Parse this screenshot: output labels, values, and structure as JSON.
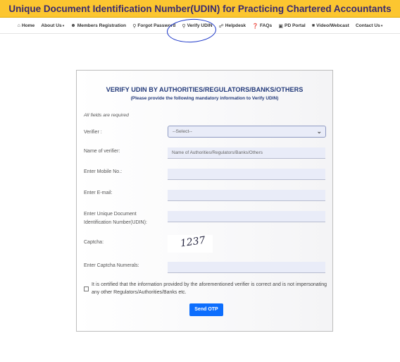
{
  "banner": {
    "title": "Unique Document Identification Number(UDIN) for Practicing Chartered Accountants"
  },
  "nav": {
    "home": "Home",
    "about": "About Us",
    "members": "Members Registration",
    "forgot": "Forgot Password",
    "verify": "Verify UDIN",
    "helpdesk": "Helpdesk",
    "faqs": "FAQs",
    "pd": "PD Portal",
    "video": "Video/Webcast",
    "contact": "Contact Us"
  },
  "form": {
    "title": "VERIFY UDIN BY AUTHORITIES/REGULATORS/BANKS/OTHERS",
    "subtitle": "(Please provide the following mandatory information to Verify UDIN)",
    "required_note": "All fields are required",
    "verifier_label": "Verifier :",
    "verifier_selected": "--Select--",
    "name_label": "Name of verifier:",
    "name_placeholder": "Name of Authorities/Regulators/Banks/Others",
    "mobile_label": "Enter Mobile No.:",
    "email_label": "Enter E-mail:",
    "udin_label_1": "Enter Unique Document",
    "udin_label_2": "Identification Number(UDIN):",
    "captcha_label": "Captcha:",
    "captcha_value": "1237",
    "captcha_input_label": "Enter Captcha Numerals:",
    "certify_text": "It is certified that the information provided by the aforementioned verifier is correct and is not impersonating any other Regulators/Authorities/Banks etc.",
    "submit_label": "Send OTP"
  },
  "colors": {
    "banner_bg": "#fcc630",
    "banner_text": "#3a2a6e",
    "heading": "#233a7a",
    "button": "#0d6efd",
    "field_bg": "#e9ecf8",
    "annotation": "#1a35c8"
  }
}
